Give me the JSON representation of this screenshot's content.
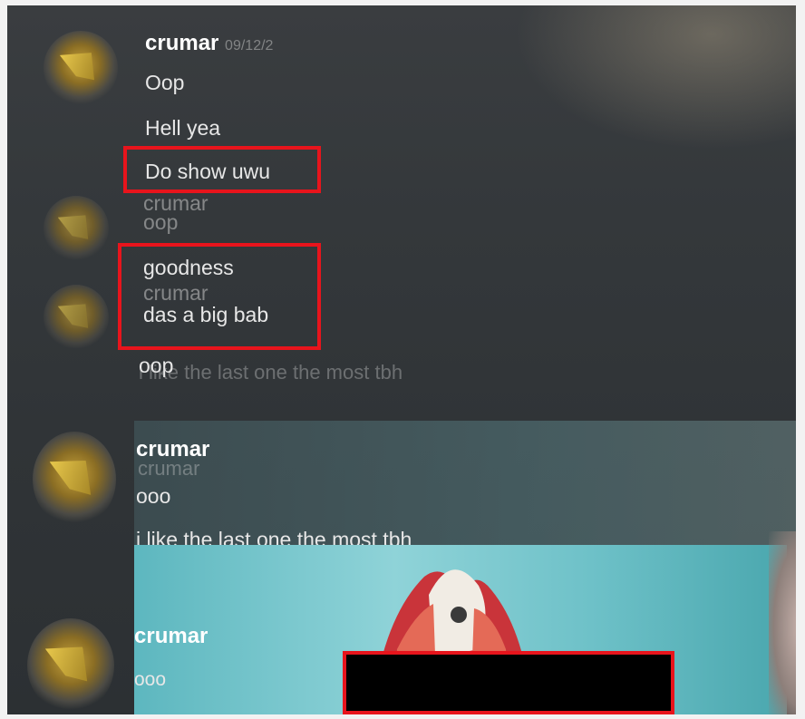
{
  "messages": {
    "g1": {
      "author": "crumar",
      "time": "09/12/2",
      "lines": [
        "Oop",
        "Hell yea",
        "Do show uwu"
      ]
    },
    "g2": {
      "author": "crumar",
      "lines": [
        "oop",
        "goodness"
      ]
    },
    "g3": {
      "author": "crumar",
      "lines": [
        "das a big bab"
      ]
    },
    "g4": {
      "lines": [
        "oop",
        "i like the last one the most tbh"
      ]
    },
    "g5": {
      "author": "crumar",
      "ghost_author": "crumar",
      "lines": [
        "ooo",
        "i like the last one the most tbh"
      ]
    },
    "g6": {
      "author": "crumar",
      "lines": [
        "ooo"
      ]
    }
  },
  "highlight_color": "#e8141c",
  "redaction_color": "#000000"
}
